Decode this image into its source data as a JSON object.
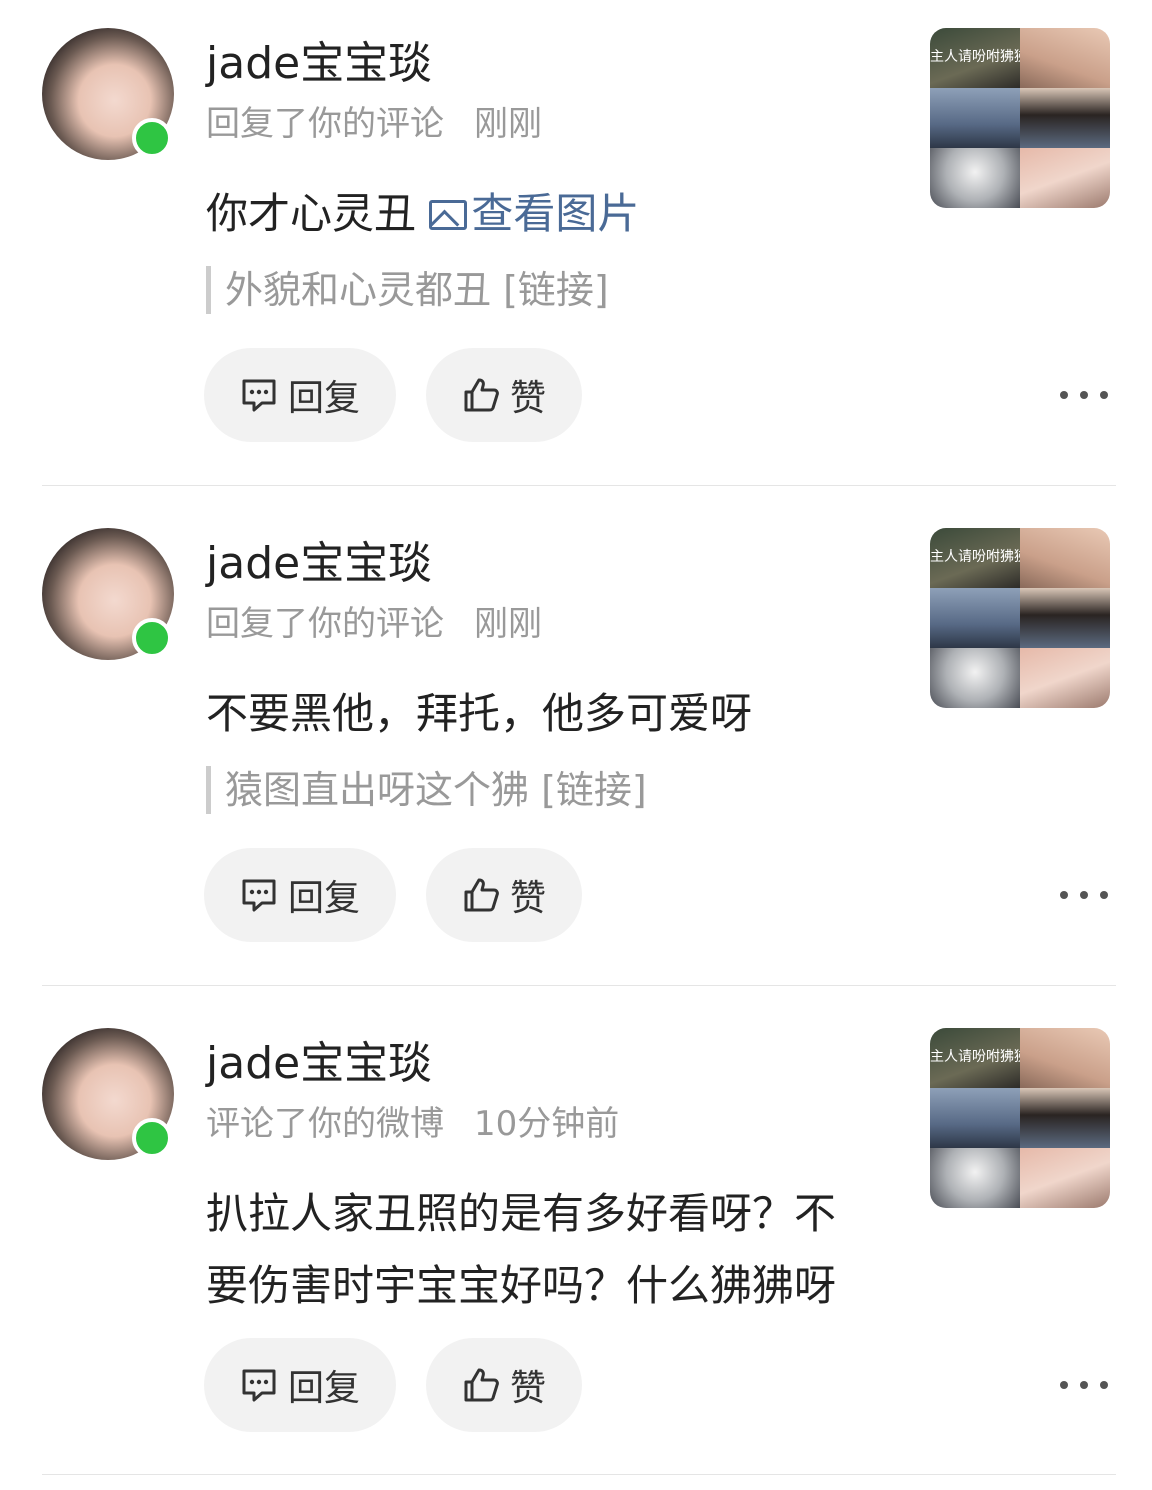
{
  "items": [
    {
      "user": "jade宝宝琰",
      "action": "回复了你的评论",
      "time": "刚刚",
      "content": "你才心灵丑 ",
      "link_text": "查看图片",
      "quote": "外貌和心灵都丑 [链接]",
      "reply_label": "回复",
      "like_label": "赞",
      "thumb_caption": "主人请吩咐狒狒"
    },
    {
      "user": "jade宝宝琰",
      "action": "回复了你的评论",
      "time": "刚刚",
      "content": "不要黑他，拜托，他多可爱呀",
      "quote": "猿图直出呀这个狒 [链接]",
      "reply_label": "回复",
      "like_label": "赞",
      "thumb_caption": "主人请吩咐狒狒"
    },
    {
      "user": "jade宝宝琰",
      "action": "评论了你的微博",
      "time": "10分钟前",
      "content_line1": "扒拉人家丑照的是有多好看呀？不",
      "content_line2": "要伤害时宇宝宝好吗？什么狒狒呀",
      "reply_label": "回复",
      "like_label": "赞",
      "thumb_caption": "主人请吩咐狒狒"
    }
  ],
  "icons": {
    "reply": "comment-bubble-icon",
    "like": "thumbs-up-icon",
    "more": "more-dots-icon",
    "image_link": "picture-icon"
  },
  "colors": {
    "online": "#2fc543",
    "link": "#4a6a96",
    "muted": "#999999",
    "button_bg": "#f2f2f2"
  }
}
